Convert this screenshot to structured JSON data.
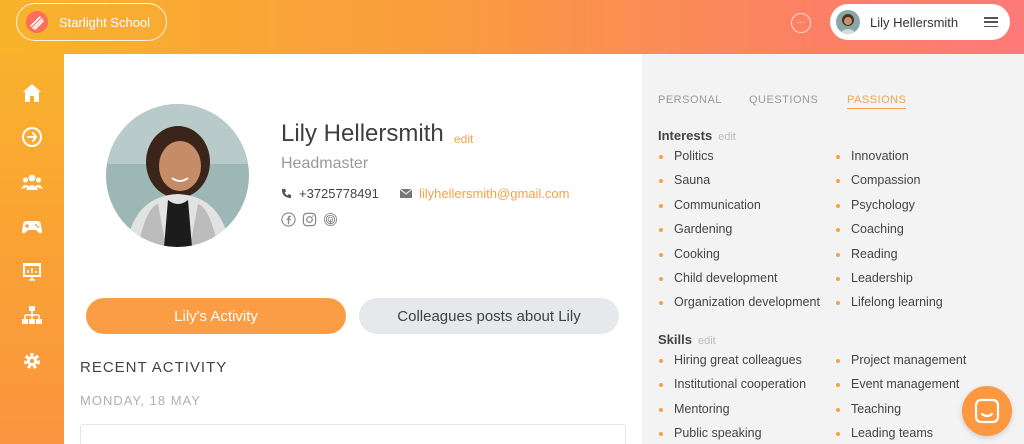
{
  "brand": {
    "name": "Starlight School"
  },
  "header": {
    "user_name": "Lily Hellersmith"
  },
  "profile": {
    "name": "Lily Hellersmith",
    "edit_label": "edit",
    "title": "Headmaster",
    "phone": "+3725778491",
    "email": "lilyhellersmith@gmail.com"
  },
  "activity_tabs": {
    "own": "Lily's Activity",
    "colleagues": "Colleagues posts about Lily"
  },
  "activity": {
    "heading": "RECENT ACTIVITY",
    "date": "MONDAY, 18 MAY"
  },
  "right_tabs": {
    "personal": "PERSONAL",
    "questions": "QUESTIONS",
    "passions": "PASSIONS",
    "active": "passions"
  },
  "interests": {
    "title": "Interests",
    "edit_label": "edit",
    "items": [
      "Politics",
      "Innovation",
      "Sauna",
      "Compassion",
      "Communication",
      "Psychology",
      "Gardening",
      "Coaching",
      "Cooking",
      "Reading",
      "Child development",
      "Leadership",
      "Organization development",
      "Lifelong learning"
    ]
  },
  "skills": {
    "title": "Skills",
    "edit_label": "edit",
    "items": [
      "Hiring great colleagues",
      "Project management",
      "Institutional cooperation",
      "Event management",
      "Mentoring",
      "Teaching",
      "Public speaking",
      "Leading teams"
    ]
  },
  "colors": {
    "accent": "#f4a24a",
    "active_button": "#fb9d44",
    "topbar_start": "#f8b32b",
    "topbar_end": "#fd7a7a"
  },
  "icons": {
    "sidebar": [
      "home-icon",
      "arrow-right-circle-icon",
      "people-icon",
      "gamepad-icon",
      "presentation-icon",
      "org-chart-icon",
      "gear-icon"
    ],
    "socials": [
      "facebook-icon",
      "instagram-icon",
      "fingerprint-icon"
    ]
  }
}
